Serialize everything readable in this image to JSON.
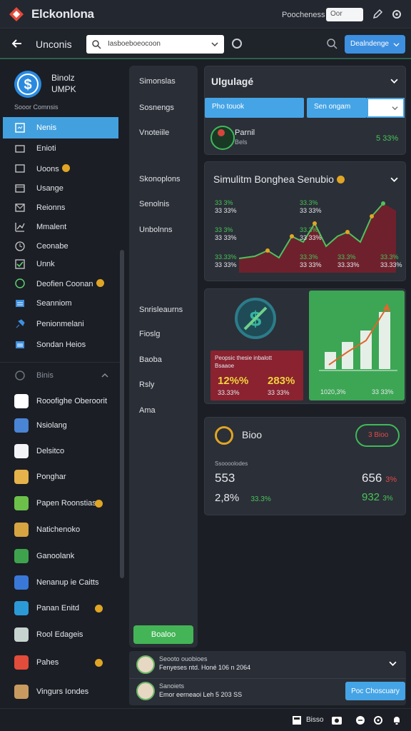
{
  "app": {
    "name": "Elckonlona",
    "top_link": "Poocheness",
    "top_input": "Oor"
  },
  "nav": {
    "back_label": "",
    "title": "Unconis",
    "search_text": "Iasboeboeocoon",
    "button_label": "Dealndenge"
  },
  "profile": {
    "name_line1": "Binolz",
    "name_line2": "UMPK",
    "subtitle": "Sooor Comnsis"
  },
  "sidebar": {
    "items": [
      {
        "label": "Nenis",
        "icon": "dashboard-icon",
        "active": true,
        "badge": false
      },
      {
        "label": "Enioti",
        "icon": "wallet-icon",
        "badge": false
      },
      {
        "label": "Uoons",
        "icon": "users-icon",
        "badge": true
      },
      {
        "label": "Usange",
        "icon": "tablet-icon",
        "badge": false
      },
      {
        "label": "Reionns",
        "icon": "mail-icon",
        "badge": false
      },
      {
        "label": "Mmalent",
        "icon": "chart-icon",
        "badge": false
      },
      {
        "label": "Ceonabe",
        "icon": "clock-icon",
        "badge": false
      },
      {
        "label": "Unnk",
        "icon": "check-icon",
        "badge": false
      },
      {
        "label": "Deofien Coonan",
        "icon": "globe-icon",
        "badge": true
      },
      {
        "label": "Seanniom",
        "icon": "list-icon",
        "badge": false
      },
      {
        "label": "Penionmelani",
        "icon": "pin-icon",
        "badge": false
      },
      {
        "label": "Sondan Heios",
        "icon": "window-icon",
        "badge": false
      }
    ],
    "group_label": "Binis",
    "apps": [
      {
        "label": "Rooofighe Oberoorit",
        "color": "#ffffff",
        "icon": "gear-app-icon"
      },
      {
        "label": "Nsiolang",
        "color": "#4a84d4",
        "icon": "grid-app-icon"
      },
      {
        "label": "Delsitco",
        "color": "#f2f4f7",
        "icon": "doc-app-icon"
      },
      {
        "label": "Ponghar",
        "color": "#e6b24a",
        "icon": "yellow-app-icon"
      },
      {
        "label": "Papen Roonstias",
        "color": "#6cc04a",
        "icon": "puzzle-app-icon",
        "badge": true
      },
      {
        "label": "Natichenoko",
        "color": "#d6a441",
        "icon": "folder-app-icon"
      },
      {
        "label": "Ganoolank",
        "color": "#3fa34e",
        "icon": "stats-app-icon"
      },
      {
        "label": "Nenanup ie Caitts",
        "color": "#3a78d8",
        "icon": "arrows-app-icon"
      },
      {
        "label": "Panan Enitd",
        "color": "#2d9ad8",
        "icon": "chart-app-icon",
        "badge": true
      },
      {
        "label": "Rool Edageis",
        "color": "#c7d4cf",
        "icon": "mint-app-icon"
      },
      {
        "label": "Pahes",
        "color": "#e24c3a",
        "icon": "red-app-icon",
        "badge": true
      },
      {
        "label": "Vingurs Iondes",
        "color": "#c99a60",
        "icon": "photo-app-icon"
      }
    ]
  },
  "middle": {
    "items": [
      "Simonslas",
      "Sosnengs",
      "Vnoteiile",
      "Skonoplons",
      "Senolnis",
      "Unbolnns",
      "Snrisleaurns",
      "Fioslg",
      "Baoba",
      "Rsly",
      "Ama"
    ],
    "button": "Boaloo"
  },
  "card1": {
    "title": "Ulgulagé",
    "btn_left": "Pho touok",
    "btn_right": "Sen ongam",
    "row_name": "Parnil",
    "row_sub": "Bels",
    "row_value": "5 33%"
  },
  "card2": {
    "title": "Simulitm Bonghea Senubio",
    "left_labels": [
      {
        "v": "33 3%",
        "s": "33 33%"
      },
      {
        "v": "33 3%",
        "s": "33 33%"
      },
      {
        "v": "33.33%",
        "s": "33 33%"
      }
    ],
    "mid_labels": [
      {
        "v": "33.3%",
        "s": "33 33%"
      },
      {
        "v": "33.3%",
        "s": "33 33%"
      },
      {
        "v": "33.3%",
        "s": "33 33%"
      }
    ],
    "right_labels": [
      {
        "v": "33.3%",
        "s": "33.33%"
      },
      {
        "v": "33.3%",
        "s": "33.33%"
      }
    ]
  },
  "card3": {
    "box_title": "Peopsic thesie inbalott",
    "box_sub": "Bsaaoe",
    "val1": "12%%",
    "val2": "283%",
    "sub1": "33.33%",
    "sub2": "33 33%",
    "g_left": "1020,3%",
    "g_right": "33 33%"
  },
  "card4": {
    "title": "Bioo",
    "toggle_label": "3 Bioo",
    "caption": "Ssoooolodes",
    "a1": "553",
    "a2": "656",
    "a2_suffix": "3%",
    "b1": "2,8%",
    "b1_sub": "33.3%",
    "b2": "932",
    "b2_suffix": "3%"
  },
  "bottom_rows": [
    {
      "line1": "Seooto ouobioes",
      "line2": "Fenyeses ntd. Honé 106 n 2064"
    },
    {
      "line1": "Sanoiets",
      "line2": "Emor eerneaoi Leh 5 203 SS"
    }
  ],
  "bottom_button": "Poc Choscuary",
  "status": {
    "label": "Bisso"
  },
  "colors": {
    "accent_blue": "#3d8fe0",
    "accent_green": "#43b556",
    "danger": "#e14a4a"
  }
}
